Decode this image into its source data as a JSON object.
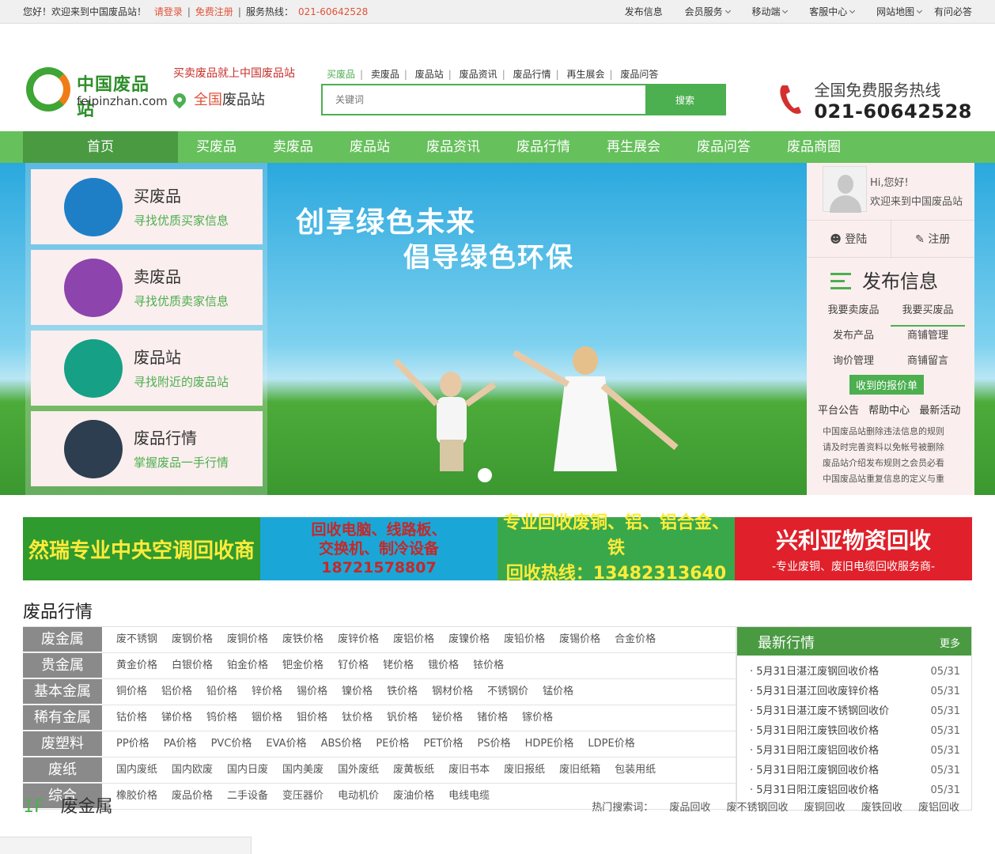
{
  "topbar": {
    "welcome": "您好！欢迎来到中国废品站！",
    "login": "请登录",
    "register": "免费注册",
    "hotline_label": "服务热线：",
    "hotline_number": "021-60642528",
    "links": [
      "发布信息",
      "会员服务",
      "移动端",
      "客服中心",
      "网站地图",
      "有问必答"
    ]
  },
  "header": {
    "brand": "中国废品站",
    "url": "feipinzhan.com",
    "slogan": "买卖废品就上中国废品站",
    "city_prefix": "全国",
    "city_suffix": "废品站",
    "search_tabs": [
      "买废品",
      "卖废品",
      "废品站",
      "废品资讯",
      "废品行情",
      "再生展会",
      "废品问答"
    ],
    "search_placeholder": "关键词",
    "search_button": "搜索",
    "hotline_title": "全国免费服务热线",
    "hotline_number": "021-60642528"
  },
  "nav": [
    "首页",
    "买废品",
    "卖废品",
    "废品站",
    "废品资讯",
    "废品行情",
    "再生展会",
    "废品问答",
    "废品商圈"
  ],
  "banner": {
    "title1": "创享绿色未来",
    "title2": "倡导绿色环保"
  },
  "categories": [
    {
      "name": "买废品",
      "desc": "寻找优质买家信息",
      "color": "#1e7fc7"
    },
    {
      "name": "卖废品",
      "desc": "寻找优质卖家信息",
      "color": "#8e44ad"
    },
    {
      "name": "废品站",
      "desc": "寻找附近的废品站",
      "color": "#16a085"
    },
    {
      "name": "废品行情",
      "desc": "掌握废品一手行情",
      "color": "#2c3e50"
    }
  ],
  "user": {
    "hi": "Hi,您好!",
    "welcome": "欢迎来到中国废品站",
    "login": "登陆",
    "register": "注册",
    "publish_title": "发布信息",
    "actions": [
      [
        "我要卖废品",
        "我要买废品"
      ],
      [
        "发布产品",
        "商铺管理"
      ],
      [
        "询价管理",
        "商铺留言"
      ]
    ],
    "quote_button": "收到的报价单",
    "notice_tabs": [
      "平台公告",
      "帮助中心",
      "最新活动"
    ],
    "notices": [
      "中国废品站删除违法信息的规则",
      "请及时完善资料以免帐号被删除",
      "废品站介绍发布规则之会员必看",
      "中国废品站重复信息的定义与重"
    ]
  },
  "ads": [
    {
      "line1": "然瑞专业中央空调回收商",
      "line2": ""
    },
    {
      "line1": "回收电脑、线路板、",
      "line2": "交换机、制冷设备",
      "line3": "18721578807"
    },
    {
      "line1": "专业回收废铜、铝、铝合金、铁",
      "line2": "回收热线：13482313640"
    },
    {
      "line1": "兴利亚物资回收",
      "line2": "-专业废铜、废旧电缆回收服务商-"
    }
  ],
  "market": {
    "title": "废品行情",
    "rows": [
      {
        "key": "废金属",
        "items": [
          "废不锈钢",
          "废钢价格",
          "废铜价格",
          "废铁价格",
          "废锌价格",
          "废铝价格",
          "废镍价格",
          "废铅价格",
          "废锡价格",
          "合金价格"
        ]
      },
      {
        "key": "贵金属",
        "items": [
          "黄金价格",
          "白银价格",
          "铂金价格",
          "钯金价格",
          "钌价格",
          "铑价格",
          "锇价格",
          "铱价格"
        ]
      },
      {
        "key": "基本金属",
        "items": [
          "铜价格",
          "铝价格",
          "铅价格",
          "锌价格",
          "锡价格",
          "镍价格",
          "铁价格",
          "钢材价格",
          "不锈钢价",
          "锰价格"
        ]
      },
      {
        "key": "稀有金属",
        "items": [
          "钴价格",
          "锑价格",
          "钨价格",
          "铟价格",
          "钼价格",
          "钛价格",
          "钒价格",
          "铋价格",
          "锗价格",
          "镓价格"
        ]
      },
      {
        "key": "废塑料",
        "items": [
          "PP价格",
          "PA价格",
          "PVC价格",
          "EVA价格",
          "ABS价格",
          "PE价格",
          "PET价格",
          "PS价格",
          "HDPE价格",
          "LDPE价格"
        ]
      },
      {
        "key": "废纸",
        "items": [
          "国内废纸",
          "国内欧废",
          "国内日废",
          "国内美废",
          "国外废纸",
          "废黄板纸",
          "废旧书本",
          "废旧报纸",
          "废旧纸箱",
          "包装用纸"
        ]
      },
      {
        "key": "综合",
        "items": [
          "橡胶价格",
          "废品价格",
          "二手设备",
          "变压器价",
          "电动机价",
          "废油价格",
          "电线电缆"
        ]
      }
    ],
    "latest_title": "最新行情",
    "more": "更多",
    "latest": [
      {
        "t": "5月31日湛江废钢回收价格",
        "d": "05/31"
      },
      {
        "t": "5月31日湛江回收废锌价格",
        "d": "05/31"
      },
      {
        "t": "5月31日湛江废不锈钢回收价",
        "d": "05/31"
      },
      {
        "t": "5月31日阳江废铁回收价格",
        "d": "05/31"
      },
      {
        "t": "5月31日阳江废铝回收价格",
        "d": "05/31"
      },
      {
        "t": "5月31日阳江废钢回收价格",
        "d": "05/31"
      },
      {
        "t": "5月31日阳江废铝回收价格",
        "d": "05/31"
      }
    ]
  },
  "floor": {
    "num": "1F",
    "title": "废金属",
    "hot_label": "热门搜索词：",
    "hot": [
      "废品回收",
      "废不锈钢回收",
      "废铜回收",
      "废铁回收",
      "废铝回收"
    ]
  }
}
